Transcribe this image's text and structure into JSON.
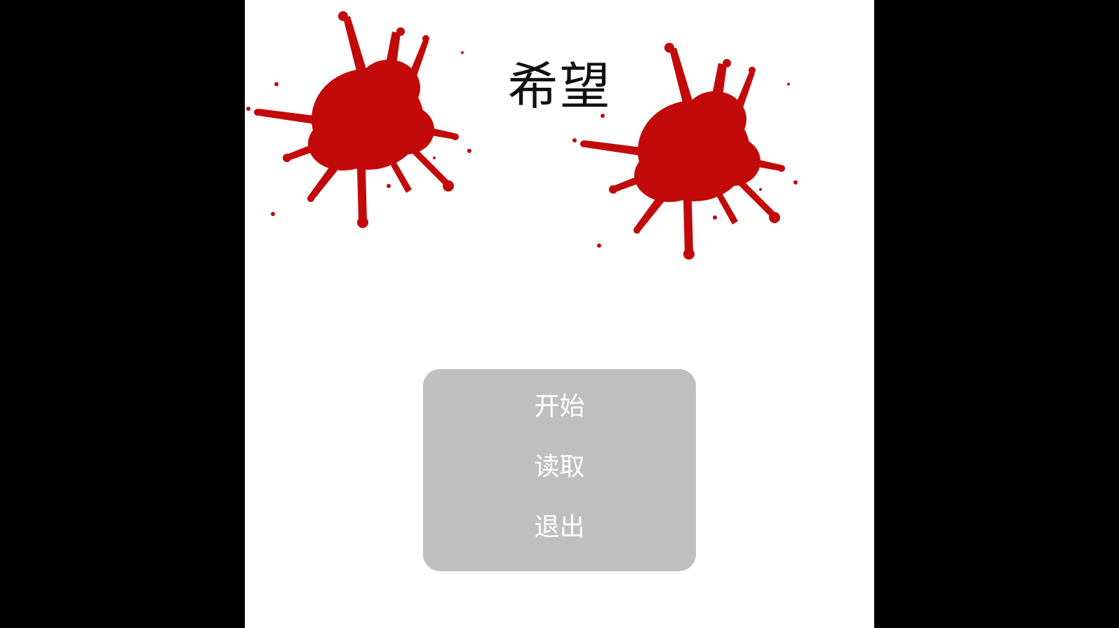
{
  "game": {
    "title": "希望",
    "menu": {
      "start_label": "开始",
      "load_label": "读取",
      "quit_label": "退出"
    }
  },
  "colors": {
    "background": "#ffffff",
    "letterbox": "#000000",
    "blood": "#c20a0a",
    "menu_panel": "#bfbfbf",
    "menu_text": "#ffffff",
    "title_text": "#111111"
  },
  "decorations": [
    "blood-splatter",
    "blood-splatter"
  ]
}
